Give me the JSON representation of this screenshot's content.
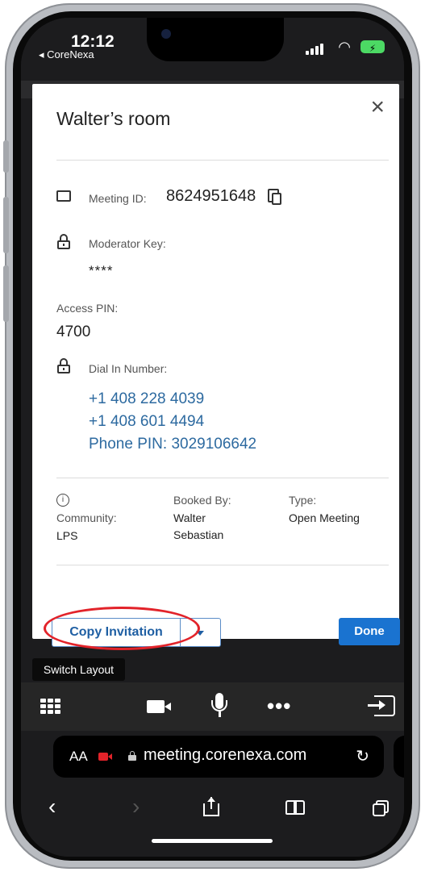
{
  "status_bar": {
    "time": "12:12",
    "back_app": "◂ CoreNexa"
  },
  "modal": {
    "title": "Walter’s room",
    "close": "×",
    "meeting_id_label": "Meeting ID:",
    "meeting_id": "8624951648",
    "moderator_key_label": "Moderator Key:",
    "moderator_key": "****",
    "access_pin_label": "Access PIN:",
    "access_pin": "4700",
    "dial_in_label": "Dial In Number:",
    "dial_in_numbers": [
      "+1 408 228 4039",
      "+1 408 601 4494",
      "Phone PIN: 3029106642"
    ],
    "community_label": "Community:",
    "community": "LPS",
    "booked_by_label": "Booked By:",
    "booked_by": [
      "Walter",
      "Sebastian"
    ],
    "type_label": "Type:",
    "type": "Open Meeting",
    "copy_invitation": "Copy Invitation",
    "done": "Done"
  },
  "meeting_toolbar": {
    "switch_layout_tip": "Switch Layout",
    "more_label": "•••"
  },
  "safari": {
    "aa": "AA",
    "url": "meeting.corenexa.com"
  },
  "annotation": {
    "highlight_color": "#e2232a"
  }
}
